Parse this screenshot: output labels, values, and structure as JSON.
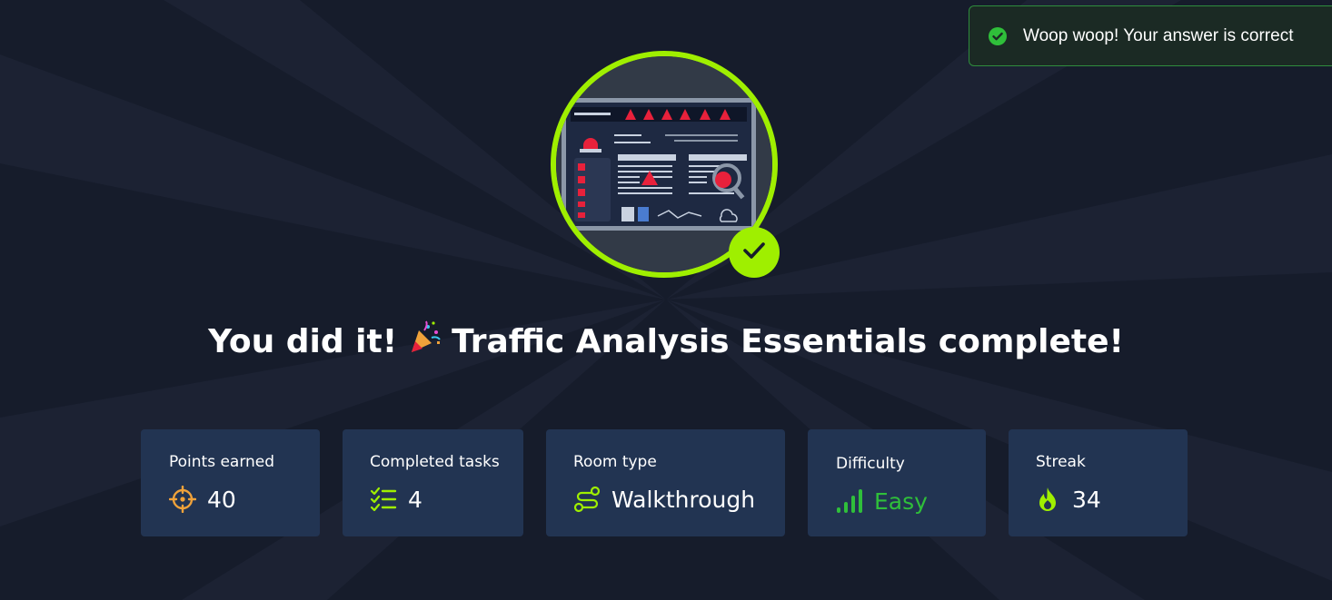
{
  "toast": {
    "message": "Woop woop! Your answer is correct",
    "icon": "check-circle-icon",
    "accent": "#2fbf3a"
  },
  "badge": {
    "image": "threat-level-dashboard-illustration",
    "ring_color": "#9fef00",
    "check_icon": "check-icon"
  },
  "headline": {
    "before": "You did it!",
    "emoji": "party-popper-icon",
    "after": "Traffic Analysis Essentials complete!"
  },
  "stats": [
    {
      "label": "Points earned",
      "value": "40",
      "icon": "crosshair-icon"
    },
    {
      "label": "Completed tasks",
      "value": "4",
      "icon": "checklist-icon"
    },
    {
      "label": "Room type",
      "value": "Walkthrough",
      "icon": "route-icon"
    },
    {
      "label": "Difficulty",
      "value": "Easy",
      "icon": "signal-bars-icon",
      "value_color": "#2fbf3a"
    },
    {
      "label": "Streak",
      "value": "34",
      "icon": "flame-icon"
    }
  ],
  "colors": {
    "background": "#161c2b",
    "card": "#223452",
    "brand_green": "#9fef00",
    "points_orange": "#f0a23a"
  }
}
